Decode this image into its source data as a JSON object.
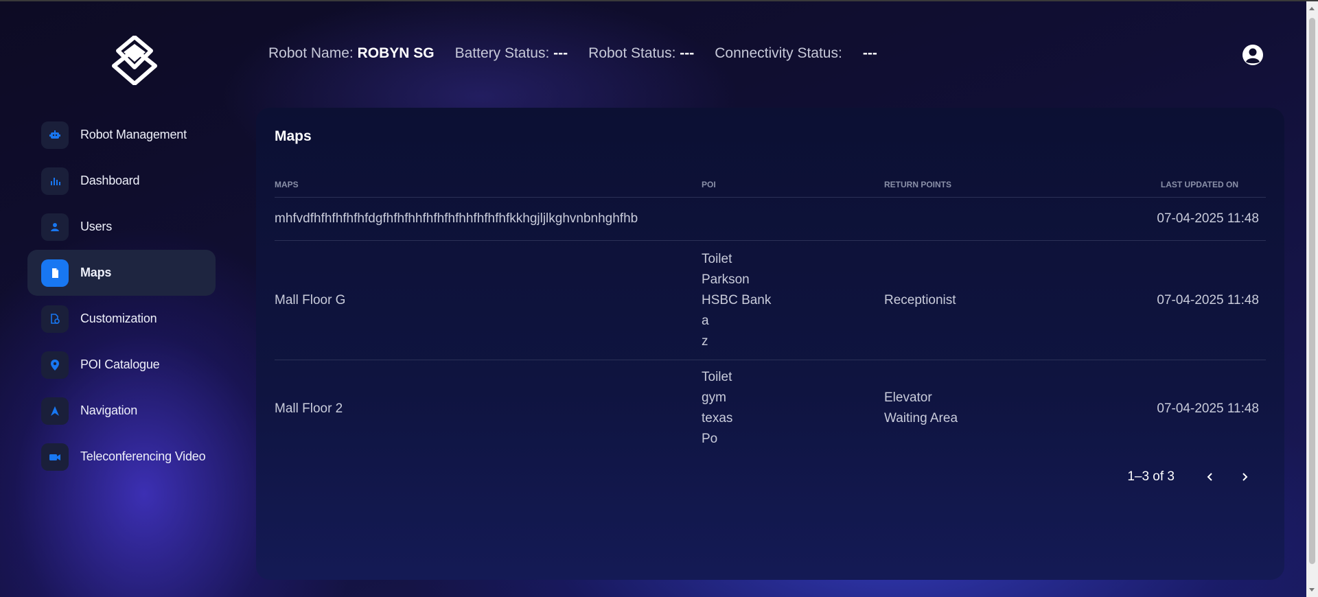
{
  "header": {
    "robot_name_label": "Robot Name:",
    "robot_name_value": "ROBYN SG",
    "battery_label": "Battery Status:",
    "battery_value": "---",
    "robot_status_label": "Robot Status:",
    "robot_status_value": "---",
    "connectivity_label": "Connectivity Status:",
    "connectivity_value": "---"
  },
  "sidebar": {
    "items": [
      {
        "label": "Robot Management",
        "icon": "robot-icon"
      },
      {
        "label": "Dashboard",
        "icon": "bar-chart-icon"
      },
      {
        "label": "Users",
        "icon": "user-icon"
      },
      {
        "label": "Maps",
        "icon": "document-icon",
        "active": true
      },
      {
        "label": "Customization",
        "icon": "customize-icon"
      },
      {
        "label": "POI Catalogue",
        "icon": "location-pin-icon"
      },
      {
        "label": "Navigation",
        "icon": "navigation-arrow-icon"
      },
      {
        "label": "Teleconferencing Video",
        "icon": "video-camera-icon"
      }
    ]
  },
  "main": {
    "title": "Maps",
    "columns": [
      "MAPS",
      "POI",
      "RETURN POINTS",
      "LAST UPDATED ON"
    ],
    "rows": [
      {
        "map": "mhfvdfhfhfhfhfhfdgfhfhfhhfhfhfhfhhfhfhfhfkkhgjljlkghvnbnhghfhb",
        "poi": [],
        "return_points": [],
        "updated": "07-04-2025 11:48"
      },
      {
        "map": "Mall Floor G",
        "poi": [
          "Toilet",
          "Parkson",
          "HSBC Bank",
          "a",
          "z"
        ],
        "return_points": [
          "Receptionist"
        ],
        "updated": "07-04-2025 11:48"
      },
      {
        "map": "Mall Floor 2",
        "poi": [
          "Toilet",
          "gym",
          "texas",
          "Po"
        ],
        "return_points": [
          "Elevator",
          "Waiting Area"
        ],
        "updated": "07-04-2025 11:48"
      }
    ],
    "pagination": "1–3 of 3"
  },
  "colors": {
    "accent": "#1877f2",
    "panel": "#0f1440",
    "active_item_bg": "#1e2540"
  }
}
